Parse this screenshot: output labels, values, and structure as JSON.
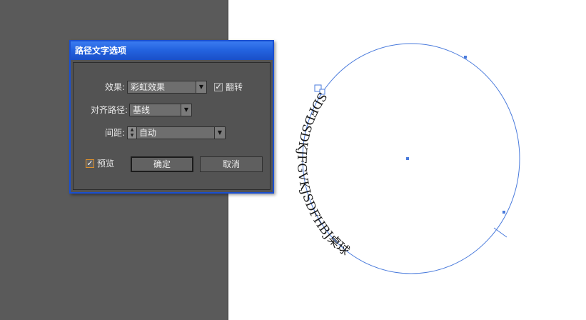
{
  "dialog": {
    "title": "路径文字选项",
    "effect": {
      "label": "效果:",
      "value": "彩虹效果"
    },
    "flip": {
      "label": "翻转",
      "checked": true
    },
    "align": {
      "label": "对齐路径:",
      "value": "基线"
    },
    "spacing": {
      "label": "间距:",
      "value": "自动"
    },
    "preview": {
      "label": "预览",
      "checked": true
    },
    "ok_label": "确定",
    "cancel_label": "取消"
  },
  "canvas": {
    "path_text": "SDFDSDKJFGVKJSDFHBJ桌球",
    "path_color": "#4a7bdc"
  }
}
